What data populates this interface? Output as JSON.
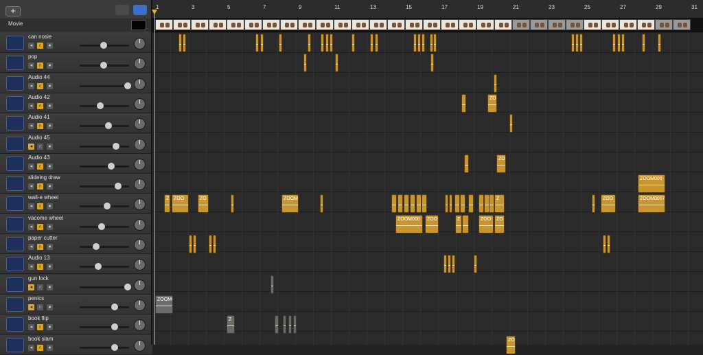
{
  "header": {
    "add_label": "+",
    "movie_label": "Movie"
  },
  "ruler": {
    "bars": [
      "1",
      "3",
      "5",
      "7",
      "9",
      "11",
      "13",
      "15",
      "17",
      "19",
      "21",
      "23",
      "25",
      "27",
      "29",
      "31"
    ]
  },
  "tracks": [
    {
      "name": "can nosie",
      "vol": 0.48,
      "mute": false,
      "solo": true
    },
    {
      "name": "pop",
      "vol": 0.48,
      "mute": false,
      "solo": true
    },
    {
      "name": "Audio 44",
      "vol": 0.97,
      "mute": false,
      "solo": true
    },
    {
      "name": "Audio 42",
      "vol": 0.41,
      "mute": false,
      "solo": true
    },
    {
      "name": "Audio 41",
      "vol": 0.58,
      "mute": false,
      "solo": true
    },
    {
      "name": "Audio 45",
      "vol": 0.73,
      "mute": true,
      "solo": false
    },
    {
      "name": "Audio 43",
      "vol": 0.64,
      "mute": false,
      "solo": true
    },
    {
      "name": "slideing draw",
      "vol": 0.78,
      "mute": false,
      "solo": true
    },
    {
      "name": "wall-e wheel",
      "vol": 0.56,
      "mute": false,
      "solo": true
    },
    {
      "name": "vacome wheel",
      "vol": 0.44,
      "mute": false,
      "solo": true
    },
    {
      "name": "paper cutter",
      "vol": 0.34,
      "mute": false,
      "solo": true
    },
    {
      "name": "Audio 13",
      "vol": 0.37,
      "mute": false,
      "solo": true
    },
    {
      "name": "gun lock",
      "vol": 0.97,
      "mute": true,
      "solo": false
    },
    {
      "name": "penics",
      "vol": 0.71,
      "mute": true,
      "solo": false
    },
    {
      "name": "book flip",
      "vol": 0.71,
      "mute": false,
      "solo": true
    },
    {
      "name": "book slam",
      "vol": 0.71,
      "mute": false,
      "solo": true
    }
  ],
  "region_labels": {
    "z": "Z",
    "zoo": "ZOO",
    "zo": "ZO",
    "zoom": "ZOOM",
    "zoom000": "ZOOM000",
    "zoom0": "ZOOM0",
    "zoom0007": "ZOOM0007"
  },
  "colors": {
    "region": "#c9952f",
    "playhead": "#e4b43a",
    "track_icon": "#1d2f5a"
  }
}
